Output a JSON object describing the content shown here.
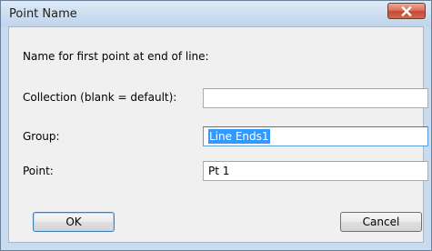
{
  "window": {
    "title": "Point Name",
    "close_icon": "close-icon"
  },
  "dialog": {
    "prompt": "Name for first point at end of line:",
    "collection": {
      "label": "Collection (blank = default):",
      "value": ""
    },
    "group": {
      "label": "Group:",
      "value": "Line Ends1"
    },
    "point": {
      "label": "Point:",
      "value": "Pt 1"
    },
    "ok_label": "OK",
    "cancel_label": "Cancel"
  },
  "colors": {
    "selection": "#3399ff",
    "close_button": "#c54a33",
    "frame": "#c9dbee"
  }
}
